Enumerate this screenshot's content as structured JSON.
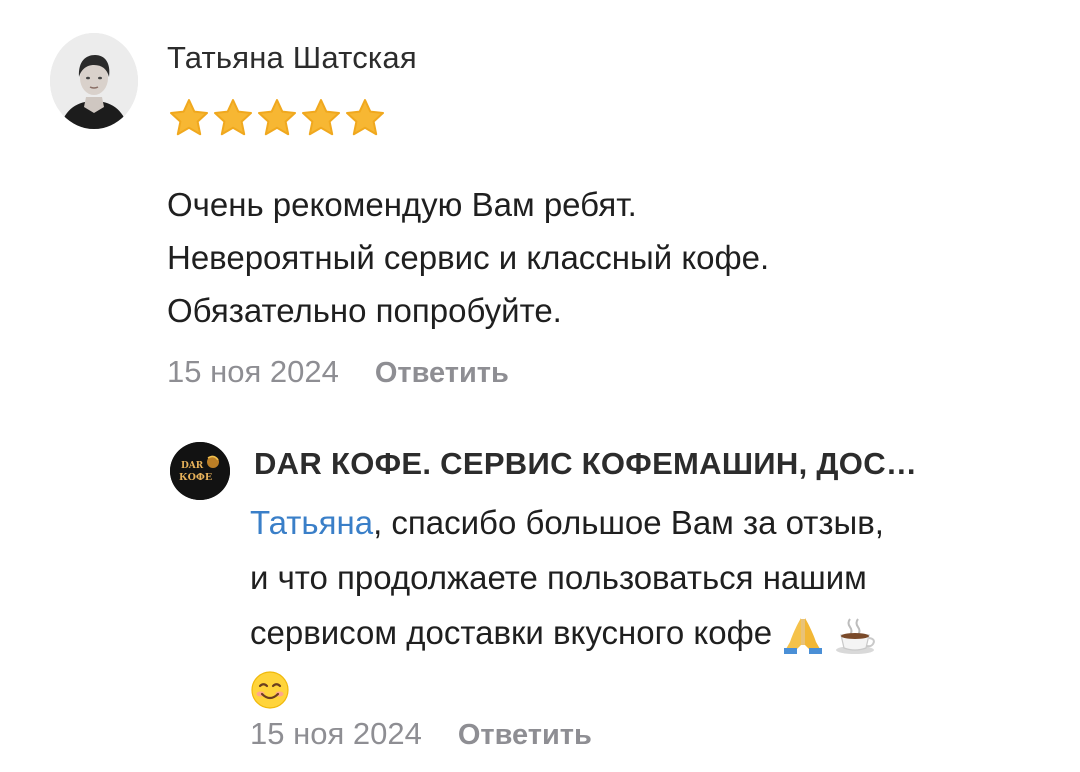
{
  "review": {
    "author_name": "Татьяна Шатская",
    "rating": 5,
    "rating_max": 5,
    "text_lines": [
      "Очень рекомендую Вам ребят.",
      "Невероятный сервис и классный кофе.",
      "Обязательно попробуйте."
    ],
    "date": "15 ноя 2024",
    "reply_label": "Ответить"
  },
  "response": {
    "author_name": "DAR КОФЕ. СЕРВИС КОФЕМАШИН, ДОС…",
    "avatar_logo_top": "DAR",
    "avatar_logo_bottom": "КОФЕ",
    "mention": "Татьяна",
    "line1_rest": ", спасибо большое Вам за отзыв,",
    "line2": "и что продолжаете пользоваться нашим",
    "line3": "сервисом доставки вкусного кофе",
    "emojis": [
      "folded-hands",
      "hot-beverage",
      "smiling-face"
    ],
    "date": "15 ноя 2024",
    "reply_label": "Ответить"
  },
  "colors": {
    "star": "#f7b733",
    "mention": "#3a7fc8",
    "meta": "#8e8e93"
  }
}
